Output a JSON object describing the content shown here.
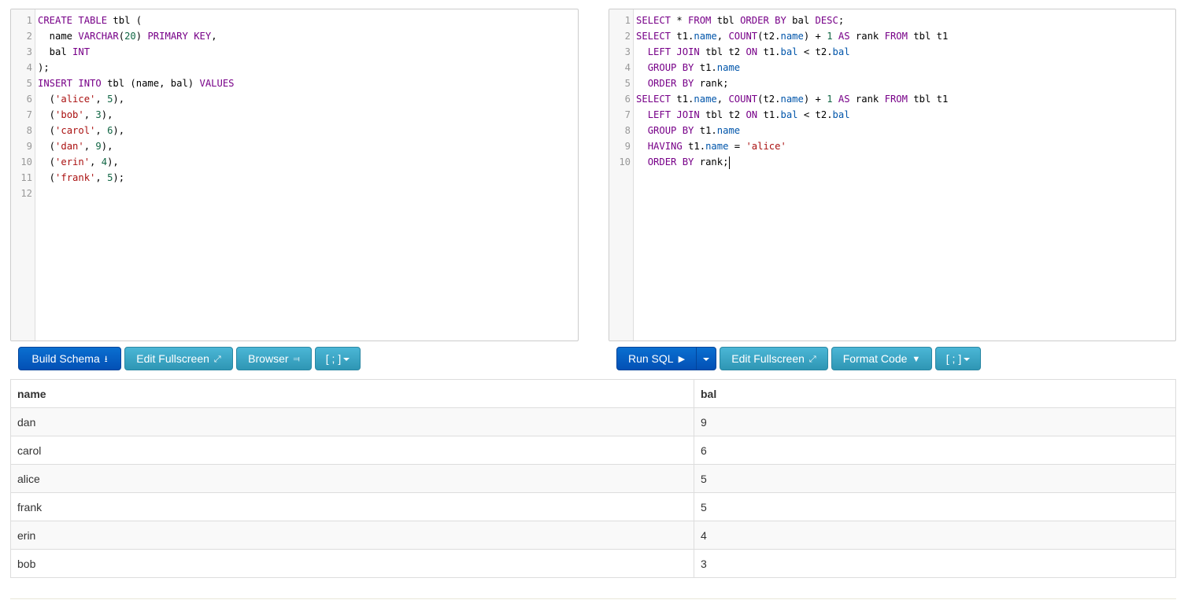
{
  "schema_editor": {
    "lines": [
      {
        "n": "1",
        "html": "<span class=\"kw\">CREATE</span> <span class=\"kw\">TABLE</span> tbl ("
      },
      {
        "n": "2",
        "html": "  name <span class=\"kw\">VARCHAR</span>(<span class=\"num\">20</span>) <span class=\"kw\">PRIMARY</span> <span class=\"kw\">KEY</span>,"
      },
      {
        "n": "3",
        "html": "  bal <span class=\"kw\">INT</span>"
      },
      {
        "n": "4",
        "html": ");"
      },
      {
        "n": "5",
        "html": "<span class=\"kw\">INSERT</span> <span class=\"kw\">INTO</span> tbl (name, bal) <span class=\"kw\">VALUES</span>"
      },
      {
        "n": "6",
        "html": "  (<span class=\"str\">'alice'</span>, <span class=\"num\">5</span>),"
      },
      {
        "n": "7",
        "html": "  (<span class=\"str\">'bob'</span>, <span class=\"num\">3</span>),"
      },
      {
        "n": "8",
        "html": "  (<span class=\"str\">'carol'</span>, <span class=\"num\">6</span>),"
      },
      {
        "n": "9",
        "html": "  (<span class=\"str\">'dan'</span>, <span class=\"num\">9</span>),"
      },
      {
        "n": "10",
        "html": "  (<span class=\"str\">'erin'</span>, <span class=\"num\">4</span>),"
      },
      {
        "n": "11",
        "html": "  (<span class=\"str\">'frank'</span>, <span class=\"num\">5</span>);"
      },
      {
        "n": "12",
        "html": ""
      }
    ]
  },
  "query_editor": {
    "lines": [
      {
        "n": "1",
        "html": "<span class=\"kw\">SELECT</span> * <span class=\"kw\">FROM</span> tbl <span class=\"kw\">ORDER</span> <span class=\"kw\">BY</span> bal <span class=\"kw\">DESC</span>;"
      },
      {
        "n": "2",
        "html": "<span class=\"kw\">SELECT</span> t1.<span class=\"prop\">name</span>, <span class=\"kw\">COUNT</span>(t2.<span class=\"prop\">name</span>) + <span class=\"num\">1</span> <span class=\"kw\">AS</span> rank <span class=\"kw\">FROM</span> tbl t1"
      },
      {
        "n": "3",
        "html": "  <span class=\"kw\">LEFT</span> <span class=\"kw\">JOIN</span> tbl t2 <span class=\"kw\">ON</span> t1.<span class=\"prop\">bal</span> &lt; t2.<span class=\"prop\">bal</span>"
      },
      {
        "n": "4",
        "html": "  <span class=\"kw\">GROUP</span> <span class=\"kw\">BY</span> t1.<span class=\"prop\">name</span>"
      },
      {
        "n": "5",
        "html": "  <span class=\"kw\">ORDER</span> <span class=\"kw\">BY</span> rank;"
      },
      {
        "n": "6",
        "html": "<span class=\"kw\">SELECT</span> t1.<span class=\"prop\">name</span>, <span class=\"kw\">COUNT</span>(t2.<span class=\"prop\">name</span>) + <span class=\"num\">1</span> <span class=\"kw\">AS</span> rank <span class=\"kw\">FROM</span> tbl t1"
      },
      {
        "n": "7",
        "html": "  <span class=\"kw\">LEFT</span> <span class=\"kw\">JOIN</span> tbl t2 <span class=\"kw\">ON</span> t1.<span class=\"prop\">bal</span> &lt; t2.<span class=\"prop\">bal</span>"
      },
      {
        "n": "8",
        "html": "  <span class=\"kw\">GROUP</span> <span class=\"kw\">BY</span> t1.<span class=\"prop\">name</span>"
      },
      {
        "n": "9",
        "html": "  <span class=\"kw\">HAVING</span> t1.<span class=\"prop\">name</span> = <span class=\"str\">'alice'</span>"
      },
      {
        "n": "10",
        "html": "  <span class=\"kw\">ORDER</span> <span class=\"kw\">BY</span> rank;<span class=\"caret\"></span>"
      }
    ]
  },
  "left_toolbar": {
    "build_schema": "Build Schema",
    "edit_fullscreen": "Edit Fullscreen",
    "browser": "Browser",
    "delimiter": "[ ; ]"
  },
  "right_toolbar": {
    "run_sql": "Run SQL",
    "edit_fullscreen": "Edit Fullscreen",
    "format_code": "Format Code",
    "delimiter": "[ ; ]"
  },
  "results": {
    "columns": [
      "name",
      "bal"
    ],
    "rows": [
      [
        "dan",
        "9"
      ],
      [
        "carol",
        "6"
      ],
      [
        "alice",
        "5"
      ],
      [
        "frank",
        "5"
      ],
      [
        "erin",
        "4"
      ],
      [
        "bob",
        "3"
      ]
    ]
  },
  "colors": {
    "keyword": "#770088",
    "number": "#116644",
    "string": "#aa1111",
    "property": "#0055aa",
    "primary_button": "#0350b5",
    "info_button": "#2f96b4"
  }
}
